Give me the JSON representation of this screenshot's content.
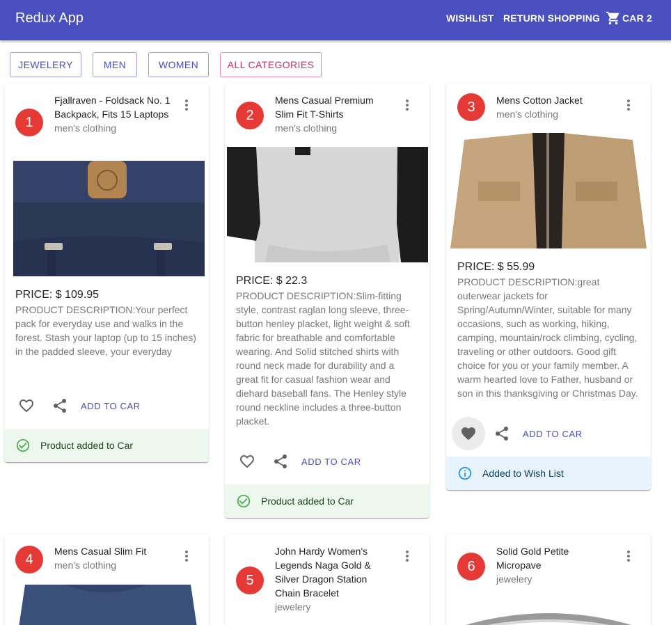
{
  "appbar": {
    "title": "Redux App",
    "wishlist": "WISHLIST",
    "return_shopping": "RETURN SHOPPING",
    "cart_label": "CAR 2"
  },
  "filters": [
    "JEWELERY",
    "MEN",
    "WOMEN",
    "ALL CATEGORIES"
  ],
  "add_label": "ADD TO CAR",
  "price_prefix": "PRICE: $",
  "products": [
    {
      "num": "1",
      "title": "Fjallraven - Foldsack No. 1 Backpack, Fits 15 Laptops",
      "category": "men's clothing",
      "price": "PRICE: $ 109.95",
      "description": "PRODUCT DESCRIPTION:Your perfect pack for everyday use and walks in the forest. Stash your laptop (up to 15 inches) in the padded sleeve, your everyday",
      "alert": "Product added to Car",
      "alert_type": "success",
      "favorited": false
    },
    {
      "num": "2",
      "title": "Mens Casual Premium Slim Fit T-Shirts",
      "category": "men's clothing",
      "price": "PRICE: $ 22.3",
      "description": "PRODUCT DESCRIPTION:Slim-fitting style, contrast raglan long sleeve, three-button henley placket, light weight & soft fabric for breathable and comfortable wearing. And Solid stitched shirts with round neck made for durability and a great fit for casual fashion wear and diehard baseball fans. The Henley style round neckline includes a three-button placket.",
      "alert": "Product added to Car",
      "alert_type": "success",
      "favorited": false
    },
    {
      "num": "3",
      "title": "Mens Cotton Jacket",
      "category": "men's clothing",
      "price": "PRICE: $ 55.99",
      "description": "PRODUCT DESCRIPTION:great outerwear jackets for Spring/Autumn/Winter, suitable for many occasions, such as working, hiking, camping, mountain/rock climbing, cycling, traveling or other outdoors. Good gift choice for you or your family member. A warm hearted love to Father, husband or son in this thanksgiving or Christmas Day.",
      "alert": "Added to Wish List",
      "alert_type": "info",
      "favorited": true
    },
    {
      "num": "4",
      "title": "Mens Casual Slim Fit",
      "category": "men's clothing"
    },
    {
      "num": "5",
      "title": "John Hardy Women's Legends Naga Gold & Silver Dragon Station Chain Bracelet",
      "category": "jewelery"
    },
    {
      "num": "6",
      "title": "Solid Gold Petite Micropave",
      "category": "jewelery"
    }
  ],
  "colors": {
    "appbar": "#4a4fbf",
    "avatar": "#e53935",
    "accent": "#4a4fbf",
    "all_categories": "#d62a5a",
    "success_bg": "#edf7ed",
    "info_bg": "#e8f4fd"
  },
  "icons": {
    "cart": "shopping-cart-icon",
    "more": "more-vert-icon",
    "favorite": "heart-icon",
    "share": "share-icon",
    "success": "check-circle-icon",
    "info": "info-icon"
  }
}
